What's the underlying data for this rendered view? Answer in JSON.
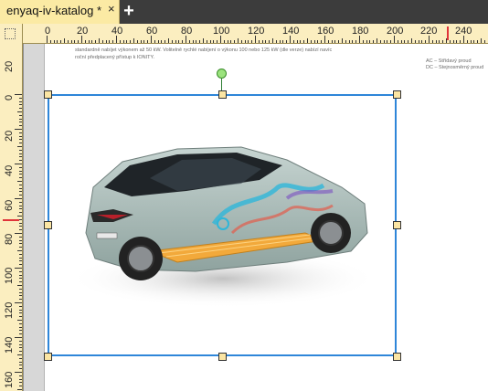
{
  "tab": {
    "title": "enyaq-iv-katalog *",
    "close": "×",
    "add": "+"
  },
  "ruler": {
    "horizontal": [
      "0",
      "20",
      "40",
      "60",
      "80",
      "100",
      "120",
      "140",
      "160",
      "180",
      "200",
      "220",
      "240"
    ],
    "vertical": [
      "20",
      "0",
      "20",
      "40",
      "60",
      "80",
      "100",
      "120",
      "140",
      "160"
    ]
  },
  "page_text": {
    "line1": "standardně nabíjet výkonem až 50 kW. Volitelně rychlé nabíjení o výkonu 100 nebo 125 kW (dle verze) nabízí navíc",
    "line2": "roční předplacený přístup k IONITY.",
    "note1": "AC – Střídavý proud",
    "note2": "DC – Stejnosměrný proud"
  },
  "image": {
    "subject": "cutaway-electric-suv-image",
    "body_color": "#a9bbb7",
    "battery_color": "#f2a93b",
    "cooling_color": "#2fb6d9"
  },
  "colors": {
    "tab_bg": "#fbeaa4",
    "ruler_bg": "#fbeec0",
    "selection": "#2e86d9",
    "marker": "#e0343a"
  }
}
